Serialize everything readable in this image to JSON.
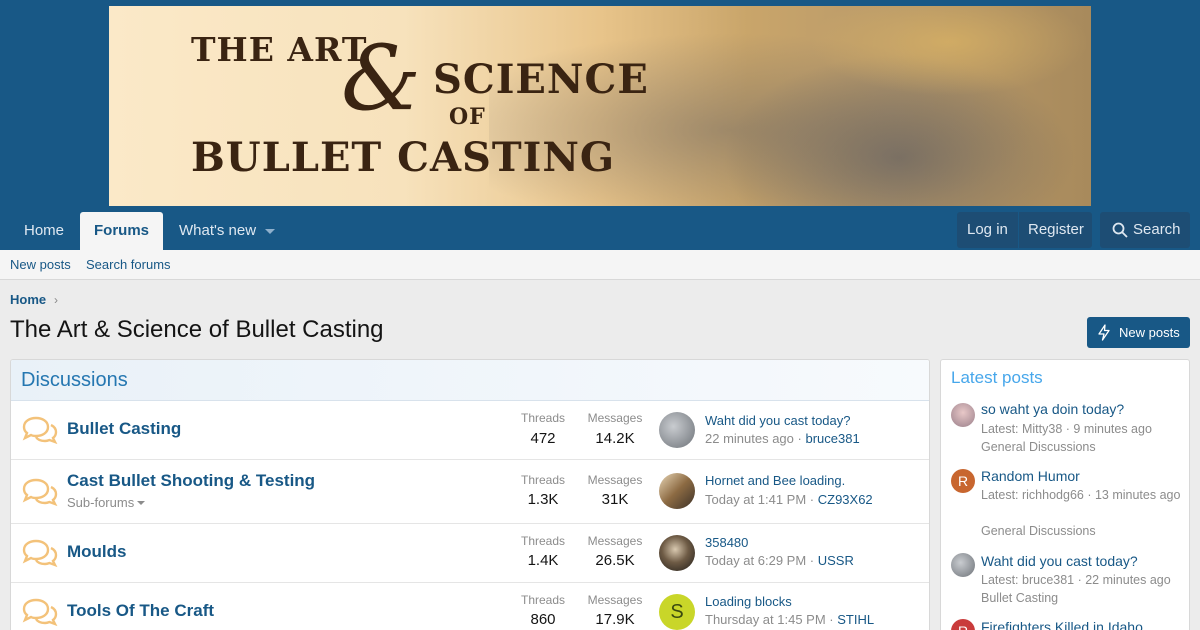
{
  "banner": {
    "line1": "THE ART",
    "amp": "&",
    "line2": "SCIENCE",
    "line3": "OF",
    "line4": "BULLET CASTING"
  },
  "nav": {
    "home": "Home",
    "forums": "Forums",
    "whats_new": "What's new",
    "login": "Log in",
    "register": "Register",
    "search": "Search"
  },
  "subnav": {
    "new_posts": "New posts",
    "search_forums": "Search forums"
  },
  "breadcrumb": "Home",
  "page_title": "The Art & Science of Bullet Casting",
  "new_posts_button": "New posts",
  "discussions": {
    "title": "Discussions",
    "threads_label": "Threads",
    "messages_label": "Messages",
    "forums": [
      {
        "title": "Bullet Casting",
        "subforums": "",
        "threads": "472",
        "messages": "14.2K",
        "latest_title": "Waht did you cast today?",
        "latest_time": "22 minutes ago",
        "latest_user": "bruce381"
      },
      {
        "title": "Cast Bullet Shooting & Testing",
        "subforums": "Sub-forums",
        "threads": "1.3K",
        "messages": "31K",
        "latest_title": "Hornet and Bee loading.",
        "latest_time": "Today at 1:41 PM",
        "latest_user": "CZ93X62"
      },
      {
        "title": "Moulds",
        "subforums": "",
        "threads": "1.4K",
        "messages": "26.5K",
        "latest_title": "358480",
        "latest_time": "Today at 6:29 PM",
        "latest_user": "USSR"
      },
      {
        "title": "Tools Of The Craft",
        "subforums": "",
        "threads": "860",
        "messages": "17.9K",
        "latest_title": "Loading blocks",
        "latest_time": "Thursday at 1:45 PM",
        "latest_user": "STIHL",
        "avatar_letter": "S"
      }
    ]
  },
  "latest_posts": {
    "title": "Latest posts",
    "items": [
      {
        "title": "so waht ya doin today?",
        "meta": "Latest: Mitty38 · 9 minutes ago",
        "forum": "General Discussions"
      },
      {
        "title": "Random Humor",
        "meta": "Latest: richhodg66 · 13 minutes ago",
        "forum": "General Discussions",
        "avatar_letter": "R"
      },
      {
        "title": "Waht did you cast today?",
        "meta": "Latest: bruce381 · 22 minutes ago",
        "forum": "Bullet Casting"
      },
      {
        "title": "Firefighters Killed in Idaho",
        "meta": "",
        "forum": "",
        "avatar_letter": "R"
      }
    ]
  },
  "colors": {
    "header_blue": "#185886",
    "link_blue": "#185886",
    "accent_light_blue": "#47a7eb",
    "forum_icon_orange": "#f3c27a"
  }
}
